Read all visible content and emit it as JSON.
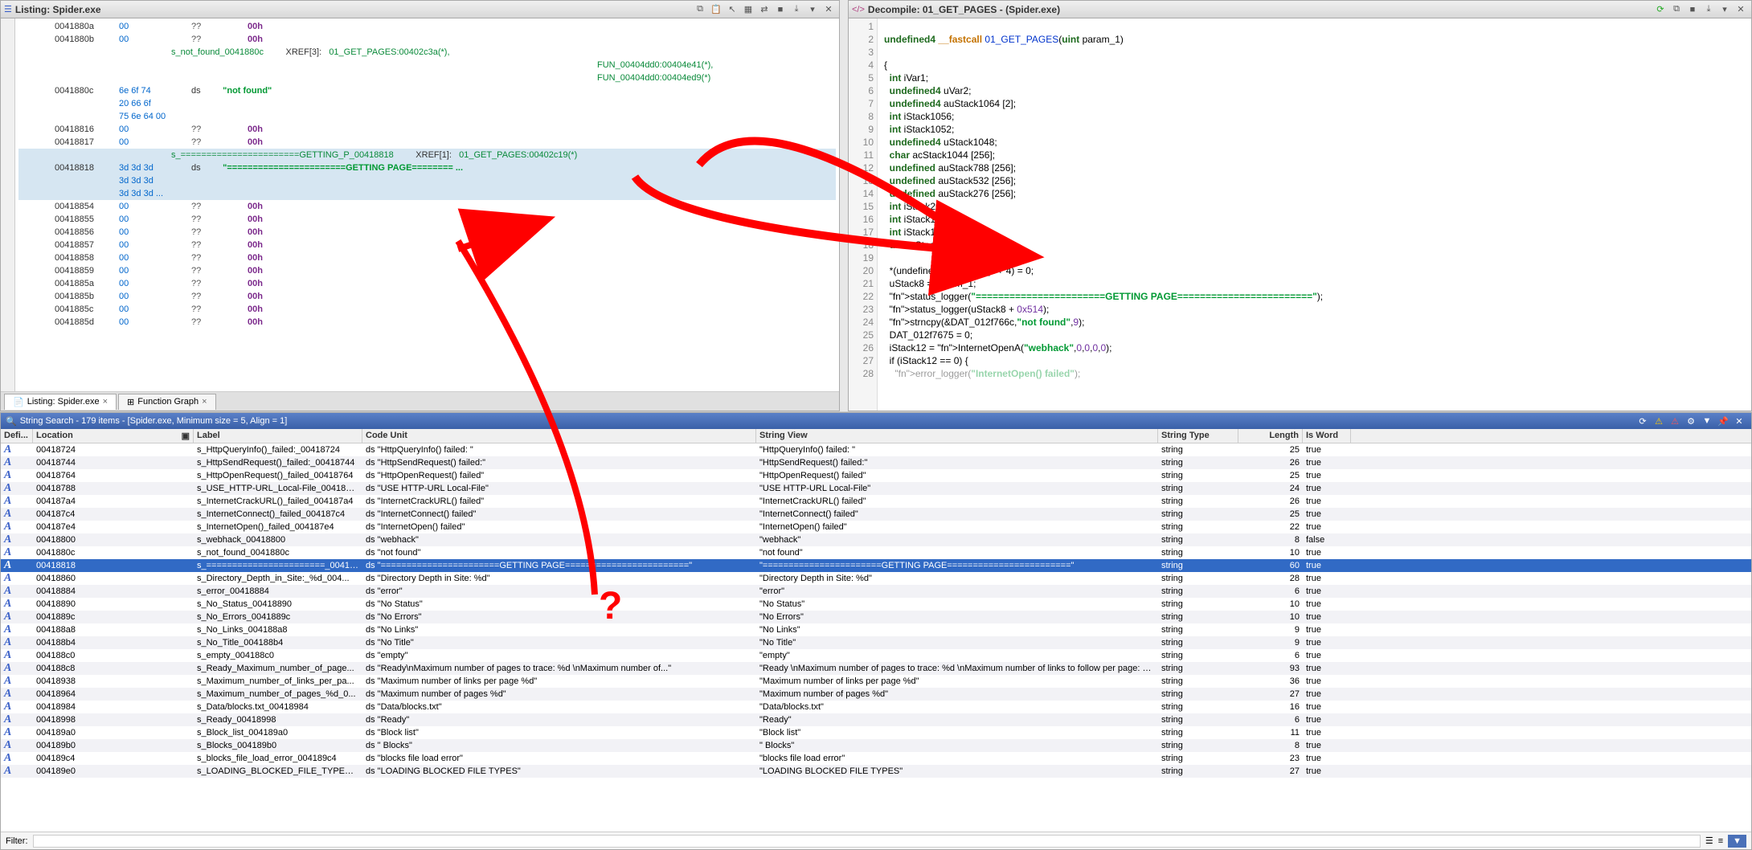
{
  "listing": {
    "title": "Listing: Spider.exe",
    "rows": [
      {
        "addr": "0041880a",
        "bytes": "00",
        "qq": "??",
        "val": "00h"
      },
      {
        "addr": "0041880b",
        "bytes": "00",
        "qq": "??",
        "val": "00h"
      },
      {
        "label": "s_not_found_0041880c",
        "xref": "XREF[3]:",
        "link": "01_GET_PAGES:00402c3a(*),"
      },
      {
        "xtra": "FUN_00404dd0:00404e41(*),"
      },
      {
        "xtra": "FUN_00404dd0:00404ed9(*)"
      },
      {
        "addr": "0041880c",
        "bytes": "6e 6f 74",
        "qq": "ds",
        "str": "\"not found\""
      },
      {
        "bytes": "20 66 6f"
      },
      {
        "bytes": "75 6e 64 00"
      },
      {
        "addr": "00418816",
        "bytes": "00",
        "qq": "??",
        "val": "00h"
      },
      {
        "addr": "00418817",
        "bytes": "00",
        "qq": "??",
        "val": "00h"
      },
      {
        "label": "s_=======================GETTING_P_00418818",
        "xref": "XREF[1]:",
        "link": "01_GET_PAGES:00402c19(*)",
        "hl": true
      },
      {
        "addr": "00418818",
        "bytes": "3d 3d 3d",
        "qq": "ds",
        "str": "\"=======================GETTING PAGE======== ...",
        "hl": true
      },
      {
        "bytes": "3d 3d 3d",
        "hl": true
      },
      {
        "bytes": "3d 3d 3d ...",
        "hl": true
      },
      {
        "addr": "00418854",
        "bytes": "00",
        "qq": "??",
        "val": "00h"
      },
      {
        "addr": "00418855",
        "bytes": "00",
        "qq": "??",
        "val": "00h"
      },
      {
        "addr": "00418856",
        "bytes": "00",
        "qq": "??",
        "val": "00h"
      },
      {
        "addr": "00418857",
        "bytes": "00",
        "qq": "??",
        "val": "00h"
      },
      {
        "addr": "00418858",
        "bytes": "00",
        "qq": "??",
        "val": "00h"
      },
      {
        "addr": "00418859",
        "bytes": "00",
        "qq": "??",
        "val": "00h"
      },
      {
        "addr": "0041885a",
        "bytes": "00",
        "qq": "??",
        "val": "00h"
      },
      {
        "addr": "0041885b",
        "bytes": "00",
        "qq": "??",
        "val": "00h"
      },
      {
        "addr": "0041885c",
        "bytes": "00",
        "qq": "??",
        "val": "00h"
      },
      {
        "addr": "0041885d",
        "bytes": "00",
        "qq": "??",
        "val": "00h"
      }
    ],
    "tabs": [
      {
        "label": "Listing: Spider.exe",
        "close": true,
        "active": true
      },
      {
        "label": "Function Graph",
        "close": true
      }
    ]
  },
  "decompile": {
    "title": "Decompile: 01_GET_PAGES - (Spider.exe)",
    "lines": [
      {
        "n": 1,
        "t": ""
      },
      {
        "n": 2,
        "t": "undefined4 __fastcall 01_GET_PAGES(uint param_1)",
        "sig": true
      },
      {
        "n": 3,
        "t": ""
      },
      {
        "n": 4,
        "t": "{"
      },
      {
        "n": 5,
        "t": "  int iVar1;",
        "decl": true
      },
      {
        "n": 6,
        "t": "  undefined4 uVar2;",
        "decl": true
      },
      {
        "n": 7,
        "t": "  undefined4 auStack1064 [2];",
        "decl": true
      },
      {
        "n": 8,
        "t": "  int iStack1056;",
        "decl": true
      },
      {
        "n": 9,
        "t": "  int iStack1052;",
        "decl": true
      },
      {
        "n": 10,
        "t": "  undefined4 uStack1048;",
        "decl": true
      },
      {
        "n": 11,
        "t": "  char acStack1044 [256];",
        "decl": true
      },
      {
        "n": 12,
        "t": "  undefined auStack788 [256];",
        "decl": true
      },
      {
        "n": 13,
        "t": "  undefined auStack532 [256];",
        "decl": true
      },
      {
        "n": 14,
        "t": "  undefined auStack276 [256];",
        "decl": true
      },
      {
        "n": 15,
        "t": "  int iStack20;",
        "decl": true
      },
      {
        "n": 16,
        "t": "  int iStack16;",
        "decl": true
      },
      {
        "n": 17,
        "t": "  int iStack12;",
        "decl": true
      },
      {
        "n": 18,
        "t": "  uint uStack8;",
        "decl": true
      },
      {
        "n": 19,
        "t": ""
      },
      {
        "n": 20,
        "t": "  *(undefined4 *)(param_1 + 4) = 0;"
      },
      {
        "n": 21,
        "t": "  uStack8 = param_1;"
      },
      {
        "n": 22,
        "t": "  status_logger(\"=======================GETTING PAGE========================\");",
        "call": true
      },
      {
        "n": 23,
        "t": "  status_logger(uStack8 + 0x514);",
        "call": true
      },
      {
        "n": 24,
        "t": "  strncpy(&DAT_012f766c,\"not found\",9);",
        "call": true
      },
      {
        "n": 25,
        "t": "  DAT_012f7675 = 0;"
      },
      {
        "n": 26,
        "t": "  iStack12 = InternetOpenA(\"webhack\",0,0,0,0);",
        "call": true
      },
      {
        "n": 27,
        "t": "  if (iStack12 == 0) {"
      },
      {
        "n": 28,
        "t": "    error_logger(\"InternetOpen() failed\");",
        "call": true,
        "faded": true
      }
    ]
  },
  "strings": {
    "title": "String Search - 179 items - [Spider.exe, Minimum size = 5, Align = 1]",
    "columns": {
      "def": "Defi...",
      "loc": "Location",
      "lbl": "Label",
      "cu": "Code Unit",
      "sv": "String View",
      "st": "String Type",
      "len": "Length",
      "wd": "Is Word"
    },
    "filter_label": "Filter:",
    "filter_value": "",
    "rows": [
      {
        "loc": "00418724",
        "lbl": "s_HttpQueryInfo()_failed:_00418724",
        "cu": "ds \"HttpQueryInfo() failed: \"",
        "sv": "\"HttpQueryInfo() failed: \"",
        "st": "string",
        "len": 25,
        "wd": "true"
      },
      {
        "loc": "00418744",
        "lbl": "s_HttpSendRequest()_failed:_00418744",
        "cu": "ds \"HttpSendRequest() failed:\"",
        "sv": "\"HttpSendRequest() failed:\"",
        "st": "string",
        "len": 26,
        "wd": "true"
      },
      {
        "loc": "00418764",
        "lbl": "s_HttpOpenRequest()_failed_00418764",
        "cu": "ds \"HttpOpenRequest() failed\"",
        "sv": "\"HttpOpenRequest() failed\"",
        "st": "string",
        "len": 25,
        "wd": "true"
      },
      {
        "loc": "00418788",
        "lbl": "s_USE_HTTP-URL_Local-File_00418788",
        "cu": "ds \"USE HTTP-URL Local-File\"",
        "sv": "\"USE HTTP-URL Local-File\"",
        "st": "string",
        "len": 24,
        "wd": "true"
      },
      {
        "loc": "004187a4",
        "lbl": "s_InternetCrackURL()_failed_004187a4",
        "cu": "ds \"InternetCrackURL() failed\"",
        "sv": "\"InternetCrackURL() failed\"",
        "st": "string",
        "len": 26,
        "wd": "true"
      },
      {
        "loc": "004187c4",
        "lbl": "s_InternetConnect()_failed_004187c4",
        "cu": "ds \"InternetConnect() failed\"",
        "sv": "\"InternetConnect() failed\"",
        "st": "string",
        "len": 25,
        "wd": "true"
      },
      {
        "loc": "004187e4",
        "lbl": "s_InternetOpen()_failed_004187e4",
        "cu": "ds \"InternetOpen() failed\"",
        "sv": "\"InternetOpen() failed\"",
        "st": "string",
        "len": 22,
        "wd": "true"
      },
      {
        "loc": "00418800",
        "lbl": "s_webhack_00418800",
        "cu": "ds \"webhack\"",
        "sv": "\"webhack\"",
        "st": "string",
        "len": 8,
        "wd": "false"
      },
      {
        "loc": "0041880c",
        "lbl": "s_not_found_0041880c",
        "cu": "ds \"not found\"",
        "sv": "\"not found\"",
        "st": "string",
        "len": 10,
        "wd": "true"
      },
      {
        "loc": "00418818",
        "lbl": "s_=======================_00418818",
        "cu": "ds \"=======================GETTING PAGE========================\"",
        "sv": "\"=======================GETTING PAGE========================\"",
        "st": "string",
        "len": 60,
        "wd": "true",
        "sel": true
      },
      {
        "loc": "00418860",
        "lbl": "s_Directory_Depth_in_Site:_%d_004...",
        "cu": "ds \"Directory Depth in Site: %d\"",
        "sv": "\"Directory Depth in Site: %d\"",
        "st": "string",
        "len": 28,
        "wd": "true"
      },
      {
        "loc": "00418884",
        "lbl": "s_error_00418884",
        "cu": "ds \"error\"",
        "sv": "\"error\"",
        "st": "string",
        "len": 6,
        "wd": "true"
      },
      {
        "loc": "00418890",
        "lbl": "s_No_Status_00418890",
        "cu": "ds \"No Status\"",
        "sv": "\"No Status\"",
        "st": "string",
        "len": 10,
        "wd": "true"
      },
      {
        "loc": "0041889c",
        "lbl": "s_No_Errors_0041889c",
        "cu": "ds \"No Errors\"",
        "sv": "\"No Errors\"",
        "st": "string",
        "len": 10,
        "wd": "true"
      },
      {
        "loc": "004188a8",
        "lbl": "s_No_Links_004188a8",
        "cu": "ds \"No Links\"",
        "sv": "\"No Links\"",
        "st": "string",
        "len": 9,
        "wd": "true"
      },
      {
        "loc": "004188b4",
        "lbl": "s_No_Title_004188b4",
        "cu": "ds \"No Title\"",
        "sv": "\"No Title\"",
        "st": "string",
        "len": 9,
        "wd": "true"
      },
      {
        "loc": "004188c0",
        "lbl": "s_empty_004188c0",
        "cu": "ds \"empty\"",
        "sv": "\"empty\"",
        "st": "string",
        "len": 6,
        "wd": "true"
      },
      {
        "loc": "004188c8",
        "lbl": "s_Ready_Maximum_number_of_page...",
        "cu": "ds \"Ready\\nMaximum number of pages to trace: %d \\nMaximum number of...\"",
        "sv": "\"Ready \\nMaximum number of pages to trace: %d \\nMaximum number of links to follow per page: %...",
        "st": "string",
        "len": 93,
        "wd": "true"
      },
      {
        "loc": "00418938",
        "lbl": "s_Maximum_number_of_links_per_pa...",
        "cu": "ds \"Maximum number of links per page %d\"",
        "sv": "\"Maximum number of links per page %d\"",
        "st": "string",
        "len": 36,
        "wd": "true"
      },
      {
        "loc": "00418964",
        "lbl": "s_Maximum_number_of_pages_%d_0...",
        "cu": "ds \"Maximum number of pages %d\"",
        "sv": "\"Maximum number of pages %d\"",
        "st": "string",
        "len": 27,
        "wd": "true"
      },
      {
        "loc": "00418984",
        "lbl": "s_Data/blocks.txt_00418984",
        "cu": "ds \"Data/blocks.txt\"",
        "sv": "\"Data/blocks.txt\"",
        "st": "string",
        "len": 16,
        "wd": "true"
      },
      {
        "loc": "00418998",
        "lbl": "s_Ready_00418998",
        "cu": "ds \"Ready\"",
        "sv": "\"Ready\"",
        "st": "string",
        "len": 6,
        "wd": "true"
      },
      {
        "loc": "004189a0",
        "lbl": "s_Block_list_004189a0",
        "cu": "ds \"Block list\"",
        "sv": "\"Block list\"",
        "st": "string",
        "len": 11,
        "wd": "true"
      },
      {
        "loc": "004189b0",
        "lbl": "s_Blocks_004189b0",
        "cu": "ds \" Blocks\"",
        "sv": "\" Blocks\"",
        "st": "string",
        "len": 8,
        "wd": "true"
      },
      {
        "loc": "004189c4",
        "lbl": "s_blocks_file_load_error_004189c4",
        "cu": "ds \"blocks file load error\"",
        "sv": "\"blocks file load error\"",
        "st": "string",
        "len": 23,
        "wd": "true"
      },
      {
        "loc": "004189e0",
        "lbl": "s_LOADING_BLOCKED_FILE_TYPES_0...",
        "cu": "ds \"LOADING BLOCKED FILE TYPES\"",
        "sv": "\"LOADING BLOCKED FILE TYPES\"",
        "st": "string",
        "len": 27,
        "wd": "true"
      }
    ]
  }
}
